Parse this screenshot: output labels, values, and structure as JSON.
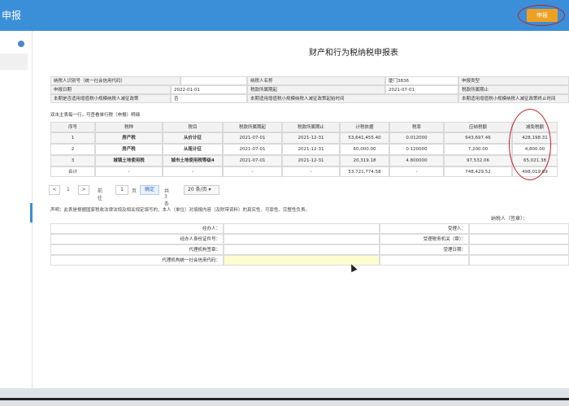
{
  "header": {
    "title": "申报",
    "submit_label": "申报"
  },
  "page_title": "财产和行为税纳税申报表",
  "info": {
    "r1": [
      "纳税人识别号（统一社会信用代码）",
      "纳税人名称",
      "厦门3836",
      "申报类型"
    ],
    "r2": [
      "申报日期",
      "2022-01-01",
      "税款所属期起",
      "2021-07-01",
      "税款所属期止"
    ],
    "r3": [
      "本期是否适用增值税小规模纳税人减征政策",
      "否",
      "本期适用增值税小规模纳税人减征政策起始时间",
      "本期适用增值税小规模纳税人减征政策终止时间"
    ]
  },
  "hint": "双击主表每一行，可查看单行税（申报）明细",
  "table": {
    "headers": [
      "序号",
      "税种",
      "税目",
      "税款所属期起",
      "税款所属期止",
      "计税依据",
      "税率",
      "应纳税额",
      "减免税额"
    ],
    "rows": [
      [
        "1",
        "房产税",
        "从价计征",
        "2021-07-01",
        "2021-12-31",
        "53,641,455.40",
        "0.012000",
        "643,697.46",
        "428,198.31"
      ],
      [
        "2",
        "房产税",
        "从租计征",
        "2021-07-01",
        "2021-12-31",
        "60,000.00",
        "0.120000",
        "7,200.00",
        "4,800.00"
      ],
      [
        "3",
        "城镇土地使用税",
        "城市土地使用税等级4",
        "2021-07-01",
        "2021-12-31",
        "20,319.18",
        "4.800000",
        "97,532.06",
        "65,021.38"
      ]
    ],
    "total": [
      "合计",
      "-",
      "-",
      "-",
      "-",
      "53,721,774.58",
      "-",
      "748,429.52",
      "498,019.69"
    ]
  },
  "pager": {
    "prev": "<",
    "page": "1",
    "next": ">",
    "goto": "前往",
    "goto_page": "1",
    "page_unit": "页",
    "confirm": "确定",
    "count": "共 3 条",
    "size": "20 条/页"
  },
  "declaration": "声明：此表是根据国家税收法律法规及相关规定填写的，本人（单位）对填报内容（及附带资料）的真实性、可靠性、完整性负责。",
  "sign_label": "纳税人（签章）：",
  "agent": {
    "handler": "经办人：",
    "handler_id": "经办人身份证件号：",
    "agency_seal": "代理机构签章：",
    "agency_code": "代理机构统一社会信用代码：",
    "receiver": "受理人：",
    "tax_office": "受理税务机关（章）：",
    "receive_date": "受理日期："
  }
}
